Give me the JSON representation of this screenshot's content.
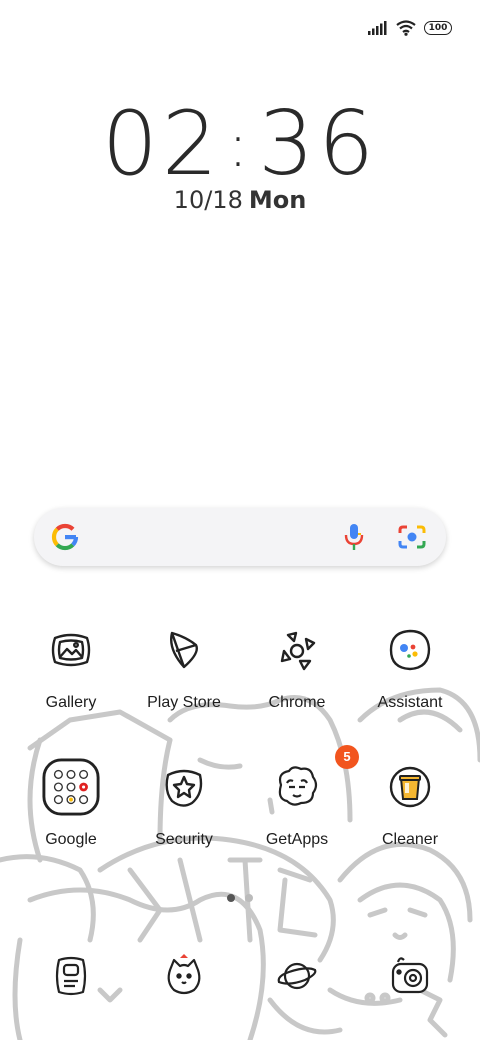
{
  "status_bar": {
    "battery": "100",
    "signal_icon": "signal-icon",
    "wifi_icon": "wifi-icon"
  },
  "clock": {
    "hours": "02",
    "minutes": "36"
  },
  "date": {
    "date": "10/18",
    "day": "Mon"
  },
  "search": {
    "logo": "google-g-icon",
    "mic": "mic-icon",
    "lens": "lens-icon"
  },
  "apps": [
    {
      "label": "Gallery",
      "icon": "gallery-icon"
    },
    {
      "label": "Play Store",
      "icon": "play-store-icon"
    },
    {
      "label": "Chrome",
      "icon": "chrome-icon"
    },
    {
      "label": "Assistant",
      "icon": "assistant-icon"
    },
    {
      "label": "Google",
      "icon": "google-folder-icon"
    },
    {
      "label": "Security",
      "icon": "security-icon"
    },
    {
      "label": "GetApps",
      "icon": "getapps-icon",
      "badge": "5"
    },
    {
      "label": "Cleaner",
      "icon": "cleaner-icon"
    }
  ],
  "dock": [
    {
      "icon": "dog-card-icon"
    },
    {
      "icon": "dog-face-icon"
    },
    {
      "icon": "planet-icon"
    },
    {
      "icon": "camera-icon"
    }
  ],
  "page_indicator": {
    "pages": 2,
    "active": 0
  },
  "colors": {
    "badge": "#f2551e",
    "google_blue": "#4285F4",
    "google_red": "#EA4335",
    "google_yellow": "#FBBC05",
    "google_green": "#34A853"
  }
}
